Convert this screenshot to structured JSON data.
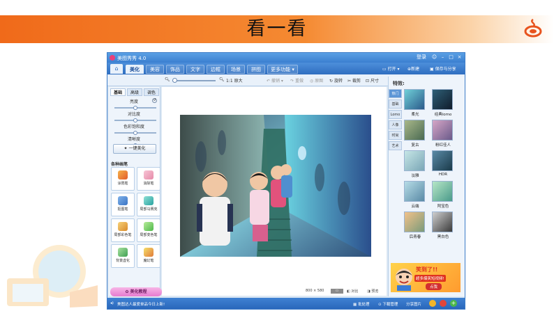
{
  "slide": {
    "title": "看一看"
  },
  "app": {
    "title": "美图秀秀 4.0",
    "window_controls": {
      "login": "登录"
    },
    "menu": {
      "home_icon": "home-icon",
      "items": [
        "美化",
        "美容",
        "饰品",
        "文字",
        "边框",
        "场景",
        "拼图",
        "更多功能"
      ],
      "active": "美化"
    },
    "right_actions": {
      "open": "打开",
      "new": "新建",
      "save_share": "保存与分享"
    },
    "toolbar": {
      "original_size": "原大",
      "undo": "撤销",
      "redo": "重做",
      "original": "原图",
      "rotate": "旋转",
      "crop": "裁剪",
      "size": "尺寸"
    },
    "left_panel": {
      "tabs": [
        "基础",
        "高级",
        "调色"
      ],
      "active_tab": "基础",
      "sliders": [
        {
          "label": "亮度",
          "value": 0.5
        },
        {
          "label": "对比度",
          "value": 0.5
        },
        {
          "label": "色彩饱和度",
          "value": 0.5
        },
        {
          "label": "清晰度",
          "value": 0.5
        }
      ],
      "one_key_label": "一键美化",
      "brushes_title": "各种画笔",
      "brushes": [
        "涂鸦笔",
        "消除笔",
        "抠图笔",
        "局部马赛克",
        "局部彩色笔",
        "局部变色笔",
        "背景虚化",
        "魔幻笔"
      ],
      "tutorial_label": "美化教程"
    },
    "canvas": {
      "dimensions": "800 × 580",
      "compare": "对比",
      "preview": "预览"
    },
    "right_panel": {
      "title": "特效:",
      "tabs": [
        "热门",
        "基础",
        "Lomo",
        "人像",
        "时尚",
        "艺术"
      ],
      "active_tab": "热门",
      "effects": [
        "柔光",
        "经典lomo",
        "复古",
        "粉红佳人",
        "淡雅",
        "HDR",
        "云端",
        "阿宝色",
        "后青春",
        "黑白色"
      ],
      "ad_text": "笑到了!!",
      "ad_sub": "超多爆笑短视频!",
      "ad_button": "点我"
    },
    "statusbar": {
      "news": "美图达人最爱单品今日上新!",
      "batch": "批处理",
      "download": "下载管理",
      "share_image": "分享图片"
    }
  },
  "colors": {
    "banner_orange": "#f06a1a",
    "app_blue": "#3b7fd0",
    "tutorial_pink": "#e67bd0"
  }
}
